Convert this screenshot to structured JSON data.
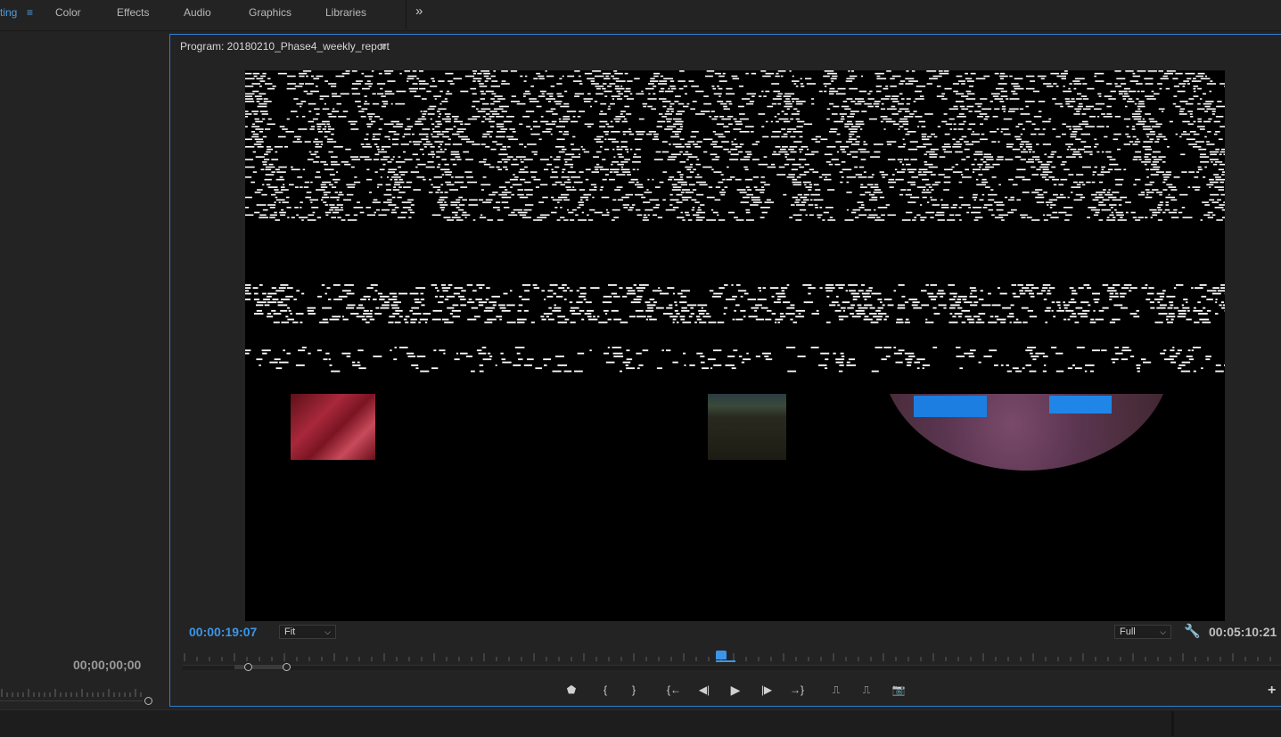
{
  "workspaces": {
    "items": [
      {
        "label": "ting",
        "active": true
      },
      {
        "label": "Color"
      },
      {
        "label": "Effects"
      },
      {
        "label": "Audio"
      },
      {
        "label": "Graphics"
      },
      {
        "label": "Libraries"
      }
    ],
    "menu_glyph": "≡",
    "more_glyph": "»"
  },
  "source_panel": {
    "timecode": "00;00;00;00",
    "add_glyph": "+"
  },
  "program": {
    "title": "Program: 20180210_Phase4_weekly_report",
    "menu_glyph": "≡",
    "current_timecode": "00:00:19:07",
    "zoom": "Fit",
    "resolution": "Full",
    "duration": "00:05:10:21",
    "wrench_glyph": "🔧",
    "add_glyph": "+",
    "playhead_fraction": 0.49,
    "transport": [
      {
        "name": "add-marker-button",
        "glyph": "⬟"
      },
      {
        "name": "mark-in-button",
        "glyph": "{"
      },
      {
        "name": "mark-out-button",
        "glyph": "}"
      },
      {
        "name": "go-to-in-button",
        "glyph": "{←"
      },
      {
        "name": "step-back-button",
        "glyph": "◀|"
      },
      {
        "name": "play-button",
        "glyph": "▶"
      },
      {
        "name": "step-forward-button",
        "glyph": "|▶"
      },
      {
        "name": "go-to-out-button",
        "glyph": "→}"
      },
      {
        "name": "lift-button",
        "glyph": "⎍"
      },
      {
        "name": "extract-button",
        "glyph": "⎍"
      },
      {
        "name": "export-frame-button",
        "glyph": "📷"
      }
    ]
  },
  "colors": {
    "accent": "#3d95e6",
    "panel_bg": "#232323",
    "panel_border": "#2f7fd1"
  }
}
